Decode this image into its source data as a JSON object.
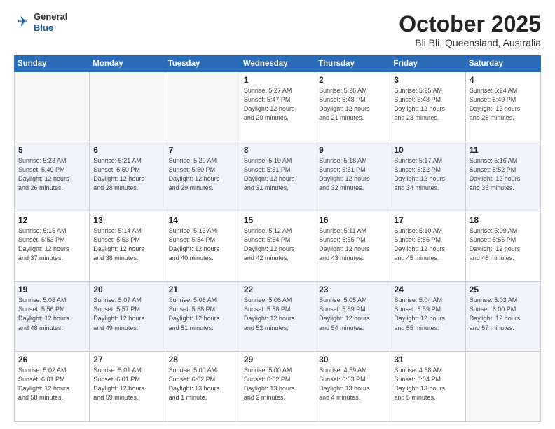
{
  "header": {
    "logo": {
      "line1": "General",
      "line2": "Blue"
    },
    "title": "October 2025",
    "location": "Bli Bli, Queensland, Australia"
  },
  "weekdays": [
    "Sunday",
    "Monday",
    "Tuesday",
    "Wednesday",
    "Thursday",
    "Friday",
    "Saturday"
  ],
  "weeks": [
    [
      {
        "day": "",
        "info": ""
      },
      {
        "day": "",
        "info": ""
      },
      {
        "day": "",
        "info": ""
      },
      {
        "day": "1",
        "info": "Sunrise: 5:27 AM\nSunset: 5:47 PM\nDaylight: 12 hours\nand 20 minutes."
      },
      {
        "day": "2",
        "info": "Sunrise: 5:26 AM\nSunset: 5:48 PM\nDaylight: 12 hours\nand 21 minutes."
      },
      {
        "day": "3",
        "info": "Sunrise: 5:25 AM\nSunset: 5:48 PM\nDaylight: 12 hours\nand 23 minutes."
      },
      {
        "day": "4",
        "info": "Sunrise: 5:24 AM\nSunset: 5:49 PM\nDaylight: 12 hours\nand 25 minutes."
      }
    ],
    [
      {
        "day": "5",
        "info": "Sunrise: 5:23 AM\nSunset: 5:49 PM\nDaylight: 12 hours\nand 26 minutes."
      },
      {
        "day": "6",
        "info": "Sunrise: 5:21 AM\nSunset: 5:50 PM\nDaylight: 12 hours\nand 28 minutes."
      },
      {
        "day": "7",
        "info": "Sunrise: 5:20 AM\nSunset: 5:50 PM\nDaylight: 12 hours\nand 29 minutes."
      },
      {
        "day": "8",
        "info": "Sunrise: 5:19 AM\nSunset: 5:51 PM\nDaylight: 12 hours\nand 31 minutes."
      },
      {
        "day": "9",
        "info": "Sunrise: 5:18 AM\nSunset: 5:51 PM\nDaylight: 12 hours\nand 32 minutes."
      },
      {
        "day": "10",
        "info": "Sunrise: 5:17 AM\nSunset: 5:52 PM\nDaylight: 12 hours\nand 34 minutes."
      },
      {
        "day": "11",
        "info": "Sunrise: 5:16 AM\nSunset: 5:52 PM\nDaylight: 12 hours\nand 35 minutes."
      }
    ],
    [
      {
        "day": "12",
        "info": "Sunrise: 5:15 AM\nSunset: 5:53 PM\nDaylight: 12 hours\nand 37 minutes."
      },
      {
        "day": "13",
        "info": "Sunrise: 5:14 AM\nSunset: 5:53 PM\nDaylight: 12 hours\nand 38 minutes."
      },
      {
        "day": "14",
        "info": "Sunrise: 5:13 AM\nSunset: 5:54 PM\nDaylight: 12 hours\nand 40 minutes."
      },
      {
        "day": "15",
        "info": "Sunrise: 5:12 AM\nSunset: 5:54 PM\nDaylight: 12 hours\nand 42 minutes."
      },
      {
        "day": "16",
        "info": "Sunrise: 5:11 AM\nSunset: 5:55 PM\nDaylight: 12 hours\nand 43 minutes."
      },
      {
        "day": "17",
        "info": "Sunrise: 5:10 AM\nSunset: 5:55 PM\nDaylight: 12 hours\nand 45 minutes."
      },
      {
        "day": "18",
        "info": "Sunrise: 5:09 AM\nSunset: 5:56 PM\nDaylight: 12 hours\nand 46 minutes."
      }
    ],
    [
      {
        "day": "19",
        "info": "Sunrise: 5:08 AM\nSunset: 5:56 PM\nDaylight: 12 hours\nand 48 minutes."
      },
      {
        "day": "20",
        "info": "Sunrise: 5:07 AM\nSunset: 5:57 PM\nDaylight: 12 hours\nand 49 minutes."
      },
      {
        "day": "21",
        "info": "Sunrise: 5:06 AM\nSunset: 5:58 PM\nDaylight: 12 hours\nand 51 minutes."
      },
      {
        "day": "22",
        "info": "Sunrise: 5:06 AM\nSunset: 5:58 PM\nDaylight: 12 hours\nand 52 minutes."
      },
      {
        "day": "23",
        "info": "Sunrise: 5:05 AM\nSunset: 5:59 PM\nDaylight: 12 hours\nand 54 minutes."
      },
      {
        "day": "24",
        "info": "Sunrise: 5:04 AM\nSunset: 5:59 PM\nDaylight: 12 hours\nand 55 minutes."
      },
      {
        "day": "25",
        "info": "Sunrise: 5:03 AM\nSunset: 6:00 PM\nDaylight: 12 hours\nand 57 minutes."
      }
    ],
    [
      {
        "day": "26",
        "info": "Sunrise: 5:02 AM\nSunset: 6:01 PM\nDaylight: 12 hours\nand 58 minutes."
      },
      {
        "day": "27",
        "info": "Sunrise: 5:01 AM\nSunset: 6:01 PM\nDaylight: 12 hours\nand 59 minutes."
      },
      {
        "day": "28",
        "info": "Sunrise: 5:00 AM\nSunset: 6:02 PM\nDaylight: 13 hours\nand 1 minute."
      },
      {
        "day": "29",
        "info": "Sunrise: 5:00 AM\nSunset: 6:02 PM\nDaylight: 13 hours\nand 2 minutes."
      },
      {
        "day": "30",
        "info": "Sunrise: 4:59 AM\nSunset: 6:03 PM\nDaylight: 13 hours\nand 4 minutes."
      },
      {
        "day": "31",
        "info": "Sunrise: 4:58 AM\nSunset: 6:04 PM\nDaylight: 13 hours\nand 5 minutes."
      },
      {
        "day": "",
        "info": ""
      }
    ]
  ]
}
